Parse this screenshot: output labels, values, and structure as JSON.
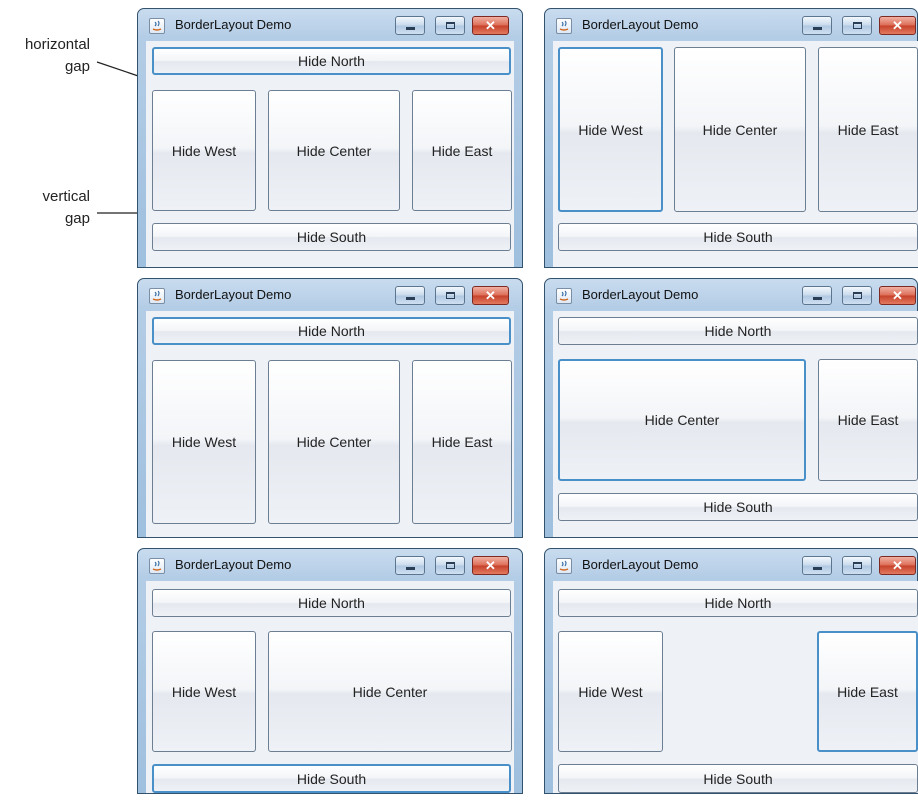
{
  "window_title": "BorderLayout Demo",
  "buttons": {
    "north": "Hide North",
    "west": "Hide West",
    "center": "Hide Center",
    "east": "Hide East",
    "south": "Hide South"
  },
  "annotations": {
    "horizontal_gap": [
      "horizontal",
      "gap"
    ],
    "vertical_gap": [
      "vertical",
      "gap"
    ]
  },
  "icons": {
    "app": "java-icon",
    "minimize": "minimize-icon",
    "maximize": "maximize-icon",
    "close": "close-icon"
  },
  "colors": {
    "frame": "#b4cde6",
    "content": "#eef1f6",
    "focus_border": "#4a90c8",
    "close_button": "#c6402a"
  }
}
